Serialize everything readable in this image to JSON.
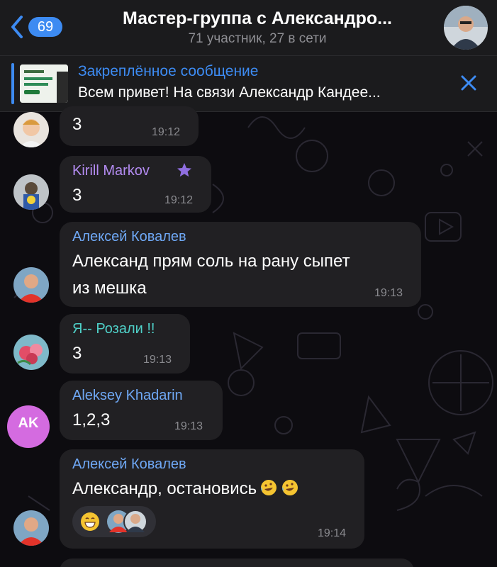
{
  "header": {
    "back_badge": "69",
    "title": "Мастер-группа с Александро...",
    "subtitle": "71 участник, 27 в сети"
  },
  "pinned": {
    "title": "Закреплённое сообщение",
    "text": "Всем привет! На связи Александр Кандее..."
  },
  "messages": [
    {
      "sender": "",
      "text": "3",
      "time": "19:12"
    },
    {
      "sender": "Kirill Markov",
      "sender_color": "#b48cf2",
      "text": "3",
      "time": "19:12",
      "badge": "star-icon"
    },
    {
      "sender": "Алексей Ковалев",
      "sender_color": "#6fa8f5",
      "lines": [
        "Александ прям соль на рану сыпет",
        "из мешка"
      ],
      "time": "19:13"
    },
    {
      "sender": "Я-- Розали !!",
      "sender_color": "#4fd0c8",
      "text": "3",
      "time": "19:13"
    },
    {
      "sender": "Aleksey Khadarin",
      "sender_color": "#6fa8f5",
      "text": "1,2,3",
      "time": "19:13",
      "avatar_initials": "AK",
      "avatar_color": "#d46be0"
    },
    {
      "sender": "Алексей Ковалев",
      "sender_color": "#6fa8f5",
      "text": "Александр, остановись",
      "time": "19:14",
      "emoji": "rofl-icon",
      "reaction": "grinning-face-icon"
    }
  ],
  "colors": {
    "accent": "#3d8bf2",
    "bubble": "#212023",
    "header": "#1b1b1d"
  }
}
